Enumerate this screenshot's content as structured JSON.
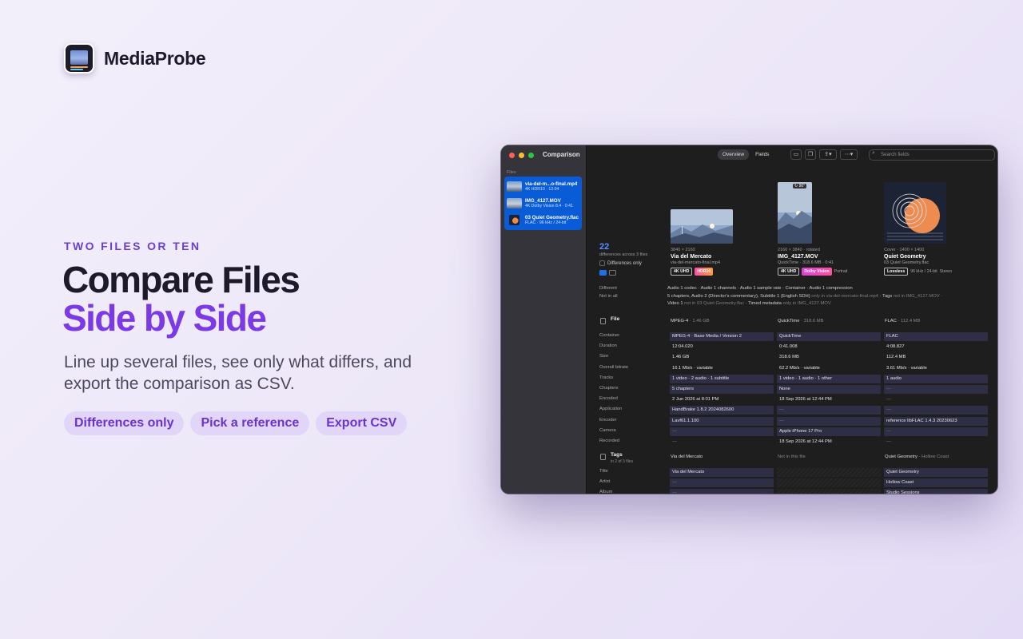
{
  "brand": {
    "name": "MediaProbe"
  },
  "hero": {
    "eyebrow": "TWO FILES OR TEN",
    "headline_line1": "Compare Files",
    "headline_line2": "Side by Side",
    "subcopy": "Line up several files, see only what differs, and export the comparison as CSV.",
    "pills": [
      "Differences only",
      "Pick a reference",
      "Export CSV"
    ]
  },
  "window": {
    "title": "Comparison",
    "sidebar_label": "Files",
    "files": [
      {
        "name": "via-del-m...o-final.mp4",
        "sub": "4K HDR10 · 12:04"
      },
      {
        "name": "IMG_4127.MOV",
        "sub": "4K Dolby Vision 8.4 · 0:41"
      },
      {
        "name": "03 Quiet Geometry.flac",
        "sub": "FLAC · 96 kHz / 24-bit"
      }
    ],
    "toolbar": {
      "tab_overview": "Overview",
      "tab_fields": "Fields",
      "search_placeholder": "Search fields"
    },
    "summary": {
      "count": "22",
      "label": "differences across 3 files",
      "differences_only": "Differences only"
    },
    "columns": [
      {
        "dims": "3840 × 2160",
        "title": "Via del Mercato",
        "sub": "via-del-mercato-final.mp4",
        "badges": [
          "4K UHD",
          "HDR10"
        ]
      },
      {
        "dims": "2160 × 3840 · rotated",
        "rotation": "90°",
        "title": "IMG_4127.MOV",
        "sub": "QuickTime · 318.6 MB · 0:41",
        "badges": [
          "4K UHD",
          "Dolby Vision",
          "Portrait"
        ]
      },
      {
        "dims": "Cover · 1400 × 1400",
        "title": "Quiet Geometry",
        "sub": "03 Quiet Geometry.flac",
        "badges": [
          "Lossless",
          "96 kHz / 24-bit",
          "Stereo"
        ]
      }
    ],
    "differences": {
      "different_label": "Different",
      "different_items": "Audio 1 codec · Audio 1 channels · Audio 1 sample rate · Container · Audio 1 compression",
      "notinall_label": "Not in all",
      "line1_a": "5 chapters, Audio 2 (Director's commentary), Subtitle 1 (English SDH)",
      "line1_b": " only in via-del-mercato-final.mp4",
      "line1_c": " · Tags",
      "line1_d": " not in IMG_4127.MOV",
      "line1_e": " ·",
      "line2_a": "Video 1",
      "line2_b": " not in 03 Quiet Geometry.flac",
      "line2_c": " · Timed metadata",
      "line2_d": " only in IMG_4127.MOV"
    },
    "file_section": {
      "name": "File",
      "col1": "MPEG-4",
      "col1m": " · 1.46 GB",
      "col2": "QuickTime",
      "col2m": " · 318.6 MB",
      "col3": "FLAC",
      "col3m": " · 112.4 MB",
      "rows": [
        {
          "label": "Container",
          "v": [
            "MPEG-4 · Base Media / Version 2",
            "QuickTime",
            "FLAC"
          ],
          "hl": true
        },
        {
          "label": "Duration",
          "v": [
            "12:04.020",
            "0:41.008",
            "4:08.827"
          ],
          "hl": false
        },
        {
          "label": "Size",
          "v": [
            "1.46 GB",
            "318.6 MB",
            "112.4 MB"
          ],
          "hl": false
        },
        {
          "label": "Overall bitrate",
          "v": [
            "16.1 Mb/s · variable",
            "62.2 Mb/s · variable",
            "3.61 Mb/s · variable"
          ],
          "hl": false
        },
        {
          "label": "Tracks",
          "v": [
            "1 video · 2 audio · 1 subtitle",
            "1 video · 1 audio · 1 other",
            "1 audio"
          ],
          "hl": true
        },
        {
          "label": "Chapters",
          "v": [
            "5 chapters",
            "None",
            "—"
          ],
          "hl": true
        },
        {
          "label": "Encoded",
          "v": [
            "2 Jun 2026 at 8:01 PM",
            "18 Sep 2026 at 12:44 PM",
            "—"
          ],
          "hl": false
        },
        {
          "label": "Application",
          "v": [
            "HandBrake 1.8.2 2024082600",
            "—",
            "—"
          ],
          "hl": true
        },
        {
          "label": "Encoder",
          "v": [
            "Lavf61.1.100",
            "—",
            "reference libFLAC 1.4.3 20230623"
          ],
          "hl": true
        },
        {
          "label": "Camera",
          "v": [
            "—",
            "Apple iPhone 17 Pro",
            "—"
          ],
          "hl": true
        },
        {
          "label": "Recorded",
          "v": [
            "—",
            "18 Sep 2026 at 12:44 PM",
            "—"
          ],
          "hl": false
        }
      ]
    },
    "tags_section": {
      "name": "Tags",
      "note": "in 2 of 3 files",
      "col1": "Via del Mercato",
      "col2": "Not in this file",
      "col3": "Quiet Geometry",
      "col3m": " · Hollow Coast",
      "rows": [
        {
          "label": "Title",
          "v": [
            "Via del Mercato",
            "",
            "Quiet Geometry"
          ]
        },
        {
          "label": "Artist",
          "v": [
            "—",
            "",
            "Hollow Coast"
          ]
        },
        {
          "label": "Album",
          "v": [
            "—",
            "",
            "Studio Sessions"
          ]
        }
      ]
    }
  }
}
